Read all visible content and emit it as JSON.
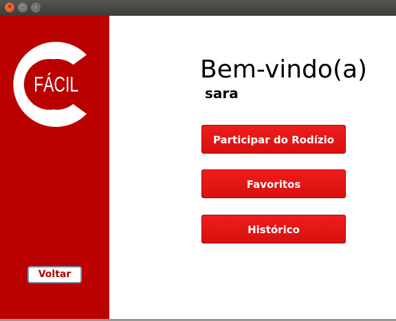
{
  "window": {
    "controls": [
      "close",
      "minimize",
      "maximize"
    ]
  },
  "sidebar": {
    "logo_text": "FÁCIL",
    "back_label": "Voltar",
    "color": "#bb0000"
  },
  "main": {
    "welcome": "Bem-vindo(a)",
    "username": "sara",
    "buttons": [
      {
        "label": "Participar do Rodízio"
      },
      {
        "label": "Favoritos"
      },
      {
        "label": "Histórico"
      }
    ],
    "button_color": "#e31414"
  }
}
